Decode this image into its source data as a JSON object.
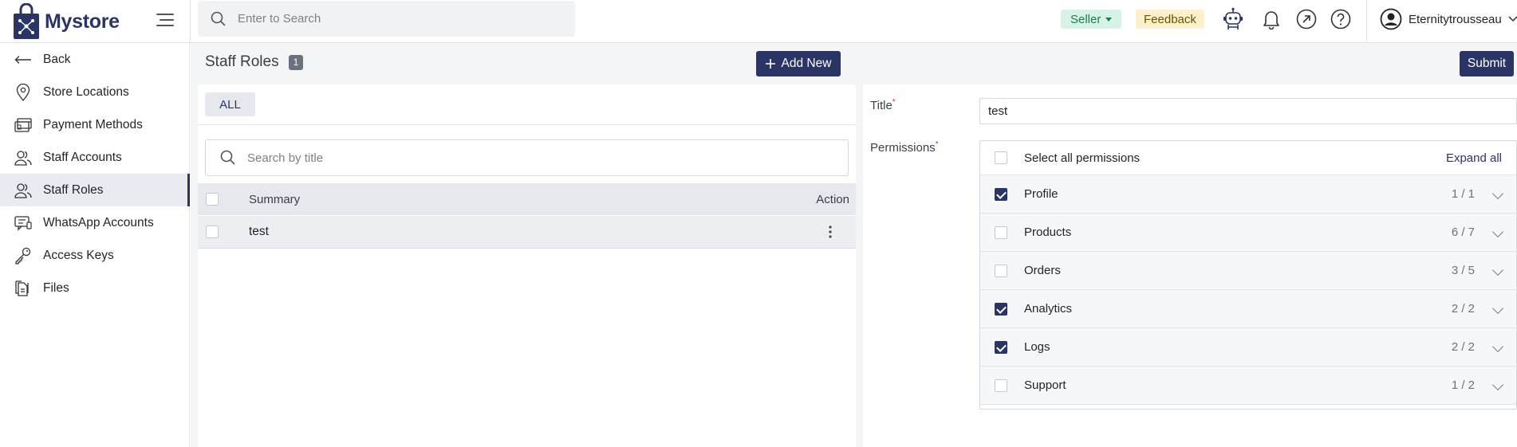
{
  "app": {
    "name": "Mystore",
    "brand_color": "#2a3465"
  },
  "topbar": {
    "search_placeholder": "Enter to Search",
    "seller_label": "Seller",
    "feedback_label": "Feedback",
    "user_name": "Eternitytrousseau",
    "icons": [
      "search-icon",
      "robot-icon",
      "bell-icon",
      "external-link-icon",
      "help-icon",
      "user-circle-icon",
      "chevron-down-icon"
    ]
  },
  "sidebar": {
    "items": [
      {
        "label": "Back",
        "icon": "arrow-left-icon"
      },
      {
        "label": "Store Locations",
        "icon": "map-pin-icon"
      },
      {
        "label": "Payment Methods",
        "icon": "payment-icon"
      },
      {
        "label": "Staff Accounts",
        "icon": "users-icon"
      },
      {
        "label": "Staff Roles",
        "icon": "users-icon",
        "active": true
      },
      {
        "label": "WhatsApp Accounts",
        "icon": "chat-icon"
      },
      {
        "label": "Access Keys",
        "icon": "keys-icon"
      },
      {
        "label": "Files",
        "icon": "files-icon"
      }
    ]
  },
  "header": {
    "title": "Staff Roles",
    "count": "1",
    "add_new_label": "Add New",
    "submit_label": "Submit"
  },
  "list": {
    "filter_tab": "ALL",
    "search_placeholder": "Search by title",
    "columns": {
      "summary": "Summary",
      "action": "Action"
    },
    "rows": [
      {
        "summary": "test"
      }
    ]
  },
  "form": {
    "title_label": "Title",
    "title_value": "test",
    "permissions_label": "Permissions",
    "select_all_label": "Select all permissions",
    "expand_all_label": "Expand all",
    "permissions": [
      {
        "name": "Profile",
        "count": "1 / 1",
        "checked": true
      },
      {
        "name": "Products",
        "count": "6 / 7",
        "checked": false
      },
      {
        "name": "Orders",
        "count": "3 / 5",
        "checked": false
      },
      {
        "name": "Analytics",
        "count": "2 / 2",
        "checked": true
      },
      {
        "name": "Logs",
        "count": "2 / 2",
        "checked": true
      },
      {
        "name": "Support",
        "count": "1 / 2",
        "checked": false
      }
    ]
  }
}
